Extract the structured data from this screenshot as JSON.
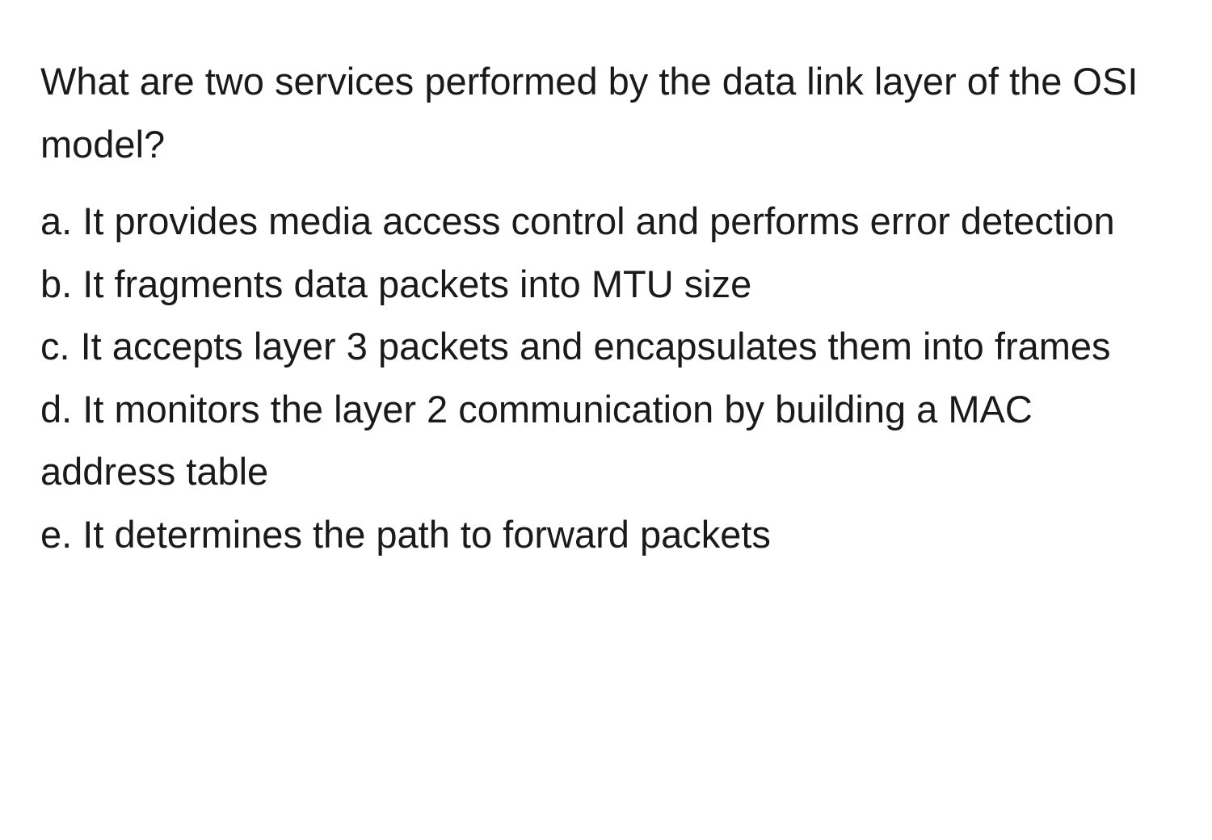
{
  "question": "What are two services performed by the data link layer of the OSI model?",
  "options": [
    {
      "letter": "a.",
      "text": "It provides media access control and performs error detection"
    },
    {
      "letter": "b.",
      "text": "It fragments data packets into MTU size"
    },
    {
      "letter": "c.",
      "text": "It accepts layer 3 packets and encapsulates them into frames"
    },
    {
      "letter": "d.",
      "text": "It monitors the layer 2 communication by building a MAC address table"
    },
    {
      "letter": "e.",
      "text": "It determines the path to forward packets"
    }
  ]
}
